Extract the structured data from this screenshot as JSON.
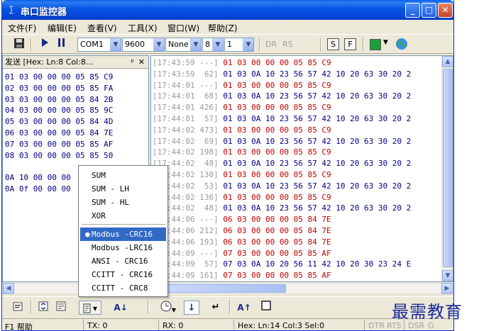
{
  "window": {
    "title": "串口监控器",
    "app_icon": "∑"
  },
  "menu": [
    "文件(F)",
    "编辑(E)",
    "查看(V)",
    "工具(X)",
    "窗口(W)",
    "帮助(Z)"
  ],
  "toolbar": {
    "port": "COM1",
    "baud": "9600",
    "parity": "None",
    "databits": "8",
    "stopbits": "1",
    "dr_label": "DR",
    "rs_label": "RS",
    "s_label": "S",
    "f_label": "F",
    "accent_green": "#1f9e3a"
  },
  "left_panel": {
    "header": "发送 [Hex: Ln:8 Col:8...",
    "pin": "ᵖ",
    "close": "✕",
    "lines": [
      "01 03 00 00 00 05 85 C9",
      "02 03 00 00 00 05 85 FA",
      "03 03 00 00 00 05 84 2B",
      "04 03 00 00 00 05 85 9C",
      "05 03 00 00 00 05 84 4D",
      "06 03 00 00 00 05 84 7E",
      "07 03 00 00 00 05 85 AF",
      "08 03 00 00 00 05 85 50",
      "",
      "0A 10 00 00 00",
      "0A 0f 00 00 00"
    ]
  },
  "log": [
    {
      "ts": "[17:43:59 ---]",
      "data": "01 03 00 00 00 05 85 C9",
      "dir": "tx"
    },
    {
      "ts": "[17:43:59  62]",
      "data": "01 03 0A 10 23 56 57 42 10 20 63 30 20 2",
      "dir": "rx"
    },
    {
      "ts": "[17:44:01 ---]",
      "data": "01 03 00 00 00 05 85 C9",
      "dir": "tx"
    },
    {
      "ts": "[17:44:01  68]",
      "data": "01 03 0A 10 23 56 57 42 10 20 63 30 20 2",
      "dir": "rx"
    },
    {
      "ts": "[17:44:01 426]",
      "data": "01 03 00 00 00 05 85 C9",
      "dir": "tx"
    },
    {
      "ts": "[17:44:01  57]",
      "data": "01 03 0A 10 23 56 57 42 10 20 63 30 20 2",
      "dir": "rx"
    },
    {
      "ts": "[17:44:02 473]",
      "data": "01 03 00 00 00 05 85 C9",
      "dir": "tx"
    },
    {
      "ts": "[17:44:02  69]",
      "data": "01 03 0A 10 23 56 57 42 10 20 63 30 20 2",
      "dir": "rx"
    },
    {
      "ts": "[17:44:02 198]",
      "data": "01 03 00 00 00 05 85 C9",
      "dir": "tx"
    },
    {
      "ts": "[17:44:02  48]",
      "data": "01 03 0A 10 23 56 57 42 10 20 63 30 20 2",
      "dir": "rx"
    },
    {
      "ts": "[17:44:02 130]",
      "data": "01 03 00 00 00 05 85 C9",
      "dir": "tx"
    },
    {
      "ts": "[17:44:02  53]",
      "data": "01 03 0A 10 23 56 57 42 10 20 63 30 20 2",
      "dir": "rx"
    },
    {
      "ts": "[17:44:02 136]",
      "data": "01 03 00 00 00 05 85 C9",
      "dir": "tx"
    },
    {
      "ts": "[17:44:02  48]",
      "data": "01 03 0A 10 23 56 57 42 10 20 63 30 20 2",
      "dir": "rx"
    },
    {
      "ts": "[17:44:06 ---]",
      "data": "06 03 00 00 00 05 84 7E",
      "dir": "tx"
    },
    {
      "ts": "[17:44:06 212]",
      "data": "06 03 00 00 00 05 84 7E",
      "dir": "tx"
    },
    {
      "ts": "[17:44:06 193]",
      "data": "06 03 00 00 00 05 84 7E",
      "dir": "tx"
    },
    {
      "ts": "[17:44:09 ---]",
      "data": "07 03 00 00 00 05 85 AF",
      "dir": "tx"
    },
    {
      "ts": "[17:44:09  57]",
      "data": "07 03 0A 10 20 56 11 42 10 20 30 23 24 E",
      "dir": "rx"
    },
    {
      "ts": "[17:44:09 161]",
      "data": "07 03 00 00 00 05 85 AF",
      "dir": "tx"
    }
  ],
  "popup_menu": {
    "items": [
      "SUM",
      "SUM - LH",
      "SUM - HL",
      "XOR",
      "Modbus -CRC16",
      "Modbus -LRC16",
      "ANSI - CRC16",
      "CCITT - CRC16",
      "CCITT - CRC8"
    ],
    "selected_index": 4
  },
  "bottom_toolbar": {
    "a_down": "A↓",
    "a_up": "A↑"
  },
  "status": {
    "help": "F1 帮助",
    "tx": "TX: 0",
    "rx": "RX: 0",
    "pos": "Hex: Ln:14  Col:3  Sel:0",
    "dtr": "DTR",
    "rts": "RTS",
    "dsr": "DSR",
    "dsr_tail": "G"
  },
  "watermark": "最需教育",
  "colors": {
    "tx": "#c00000",
    "rx": "#000088",
    "timestamp": "#9a9a9a",
    "title_blue": "#0554e3",
    "selection": "#316ac5"
  }
}
